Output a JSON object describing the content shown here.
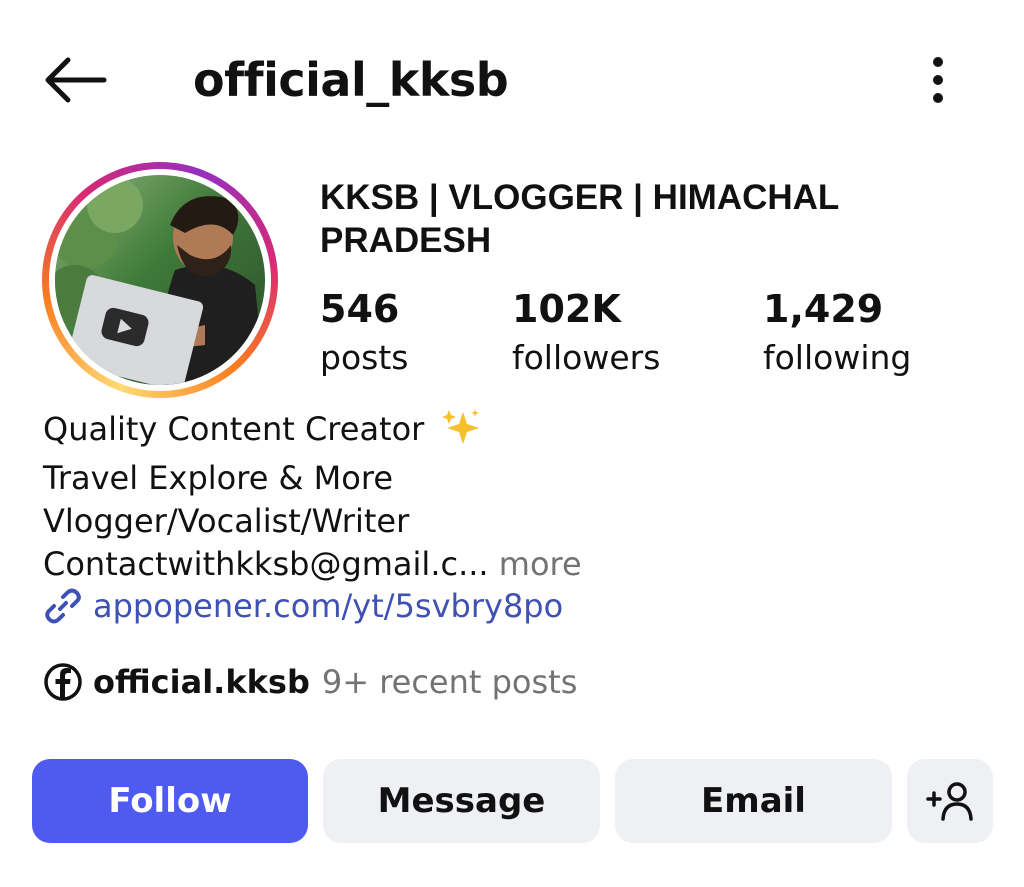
{
  "header": {
    "username": "official_kksb",
    "back_icon": "arrow-left-icon",
    "more_icon": "vertical-dots-icon"
  },
  "profile": {
    "display_name": "KKSB | VLOGGER | HIMACHAL PRADESH",
    "avatar_ring_colors": [
      "#feda75",
      "#fa7e1e",
      "#d62976",
      "#962fbf"
    ]
  },
  "stats": [
    {
      "value": "546",
      "label": "posts"
    },
    {
      "value": "102K",
      "label": "followers"
    },
    {
      "value": "1,429",
      "label": "following"
    }
  ],
  "bio": {
    "lines": [
      "Quality Content Creator",
      "Travel Explore & More",
      "Vlogger/Vocalist/Writer",
      "Contactwithkksb@gmail.c..."
    ],
    "sparkle_emoji": "✨",
    "more_label": "more",
    "link_icon": "link-icon",
    "link_text": "appopener.com/yt/5svbry8po"
  },
  "facebook": {
    "icon": "facebook-icon",
    "name": "official.kksb",
    "recent": "9+ recent posts"
  },
  "actions": {
    "follow_label": "Follow",
    "message_label": "Message",
    "email_label": "Email",
    "add_user_icon": "add-person-icon",
    "follow_color": "#4f5bf0",
    "secondary_color": "#eff0f3"
  }
}
